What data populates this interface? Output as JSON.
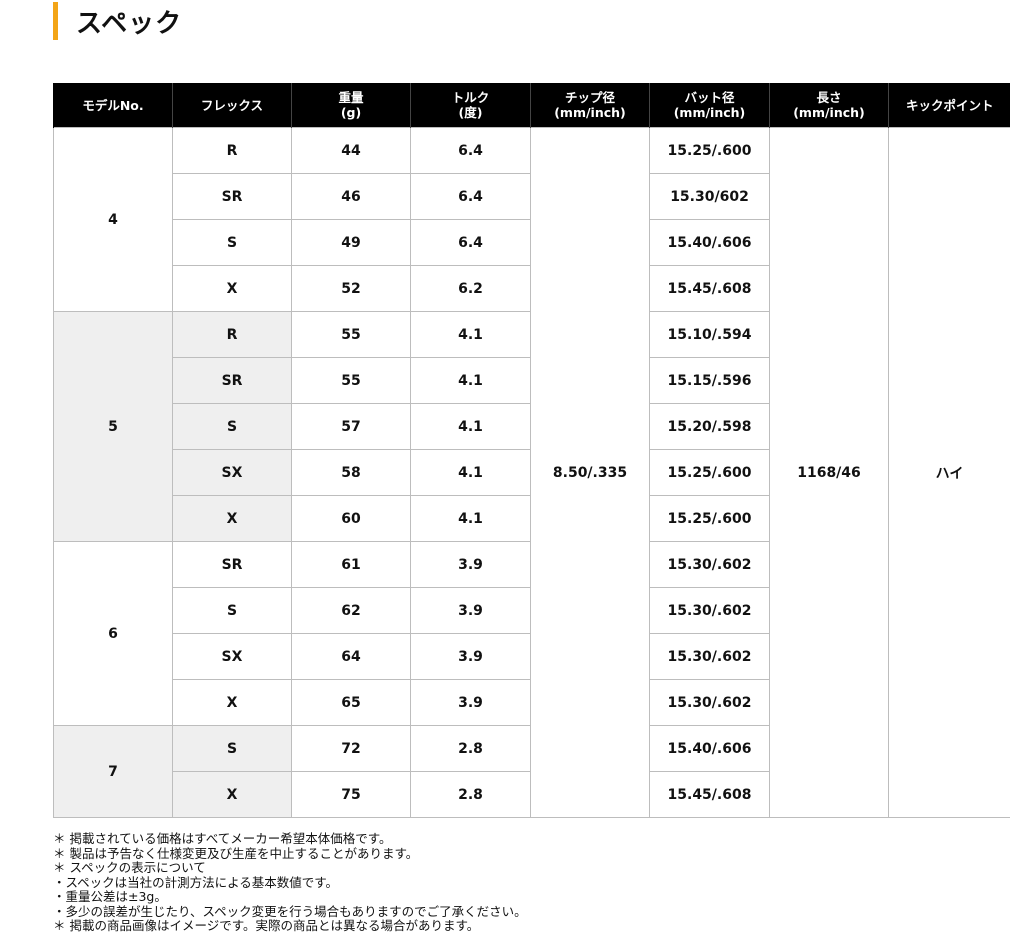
{
  "section_title": "スペック",
  "table": {
    "headers": [
      [
        "モデルNo."
      ],
      [
        "フレックス"
      ],
      [
        "重量",
        "(g)"
      ],
      [
        "トルク",
        "(度)"
      ],
      [
        "チップ径",
        "(mm/inch)"
      ],
      [
        "バット径",
        "(mm/inch)"
      ],
      [
        "長さ",
        "(mm/inch)"
      ],
      [
        "キックポイント"
      ]
    ],
    "tip_diameter": "8.50/.335",
    "length": "1168/46",
    "kick_point": "ハイ",
    "models": [
      {
        "model": "4",
        "rows": [
          {
            "flex": "R",
            "weight": "44",
            "torque": "6.4",
            "butt": "15.25/.600"
          },
          {
            "flex": "SR",
            "weight": "46",
            "torque": "6.4",
            "butt": "15.30/602"
          },
          {
            "flex": "S",
            "weight": "49",
            "torque": "6.4",
            "butt": "15.40/.606"
          },
          {
            "flex": "X",
            "weight": "52",
            "torque": "6.2",
            "butt": "15.45/.608"
          }
        ]
      },
      {
        "model": "5",
        "rows": [
          {
            "flex": "R",
            "weight": "55",
            "torque": "4.1",
            "butt": "15.10/.594"
          },
          {
            "flex": "SR",
            "weight": "55",
            "torque": "4.1",
            "butt": "15.15/.596"
          },
          {
            "flex": "S",
            "weight": "57",
            "torque": "4.1",
            "butt": "15.20/.598"
          },
          {
            "flex": "SX",
            "weight": "58",
            "torque": "4.1",
            "butt": "15.25/.600"
          },
          {
            "flex": "X",
            "weight": "60",
            "torque": "4.1",
            "butt": "15.25/.600"
          }
        ]
      },
      {
        "model": "6",
        "rows": [
          {
            "flex": "SR",
            "weight": "61",
            "torque": "3.9",
            "butt": "15.30/.602"
          },
          {
            "flex": "S",
            "weight": "62",
            "torque": "3.9",
            "butt": "15.30/.602"
          },
          {
            "flex": "SX",
            "weight": "64",
            "torque": "3.9",
            "butt": "15.30/.602"
          },
          {
            "flex": "X",
            "weight": "65",
            "torque": "3.9",
            "butt": "15.30/.602"
          }
        ]
      },
      {
        "model": "7",
        "rows": [
          {
            "flex": "S",
            "weight": "72",
            "torque": "2.8",
            "butt": "15.40/.606"
          },
          {
            "flex": "X",
            "weight": "75",
            "torque": "2.8",
            "butt": "15.45/.608"
          }
        ]
      }
    ]
  },
  "notes": [
    "＊ 掲載されている価格はすべてメーカー希望本体価格です。",
    "＊ 製品は予告なく仕様変更及び生産を中止することがあります。",
    "＊ スペックの表示について",
    "・スペックは当社の計測方法による基本数値です。",
    "・重量公差は±3g。",
    "・多少の誤差が生じたり、スペック変更を行う場合もありますのでご了承ください。",
    "＊ 掲載の商品画像はイメージです。実際の商品とは異なる場合があります。"
  ]
}
